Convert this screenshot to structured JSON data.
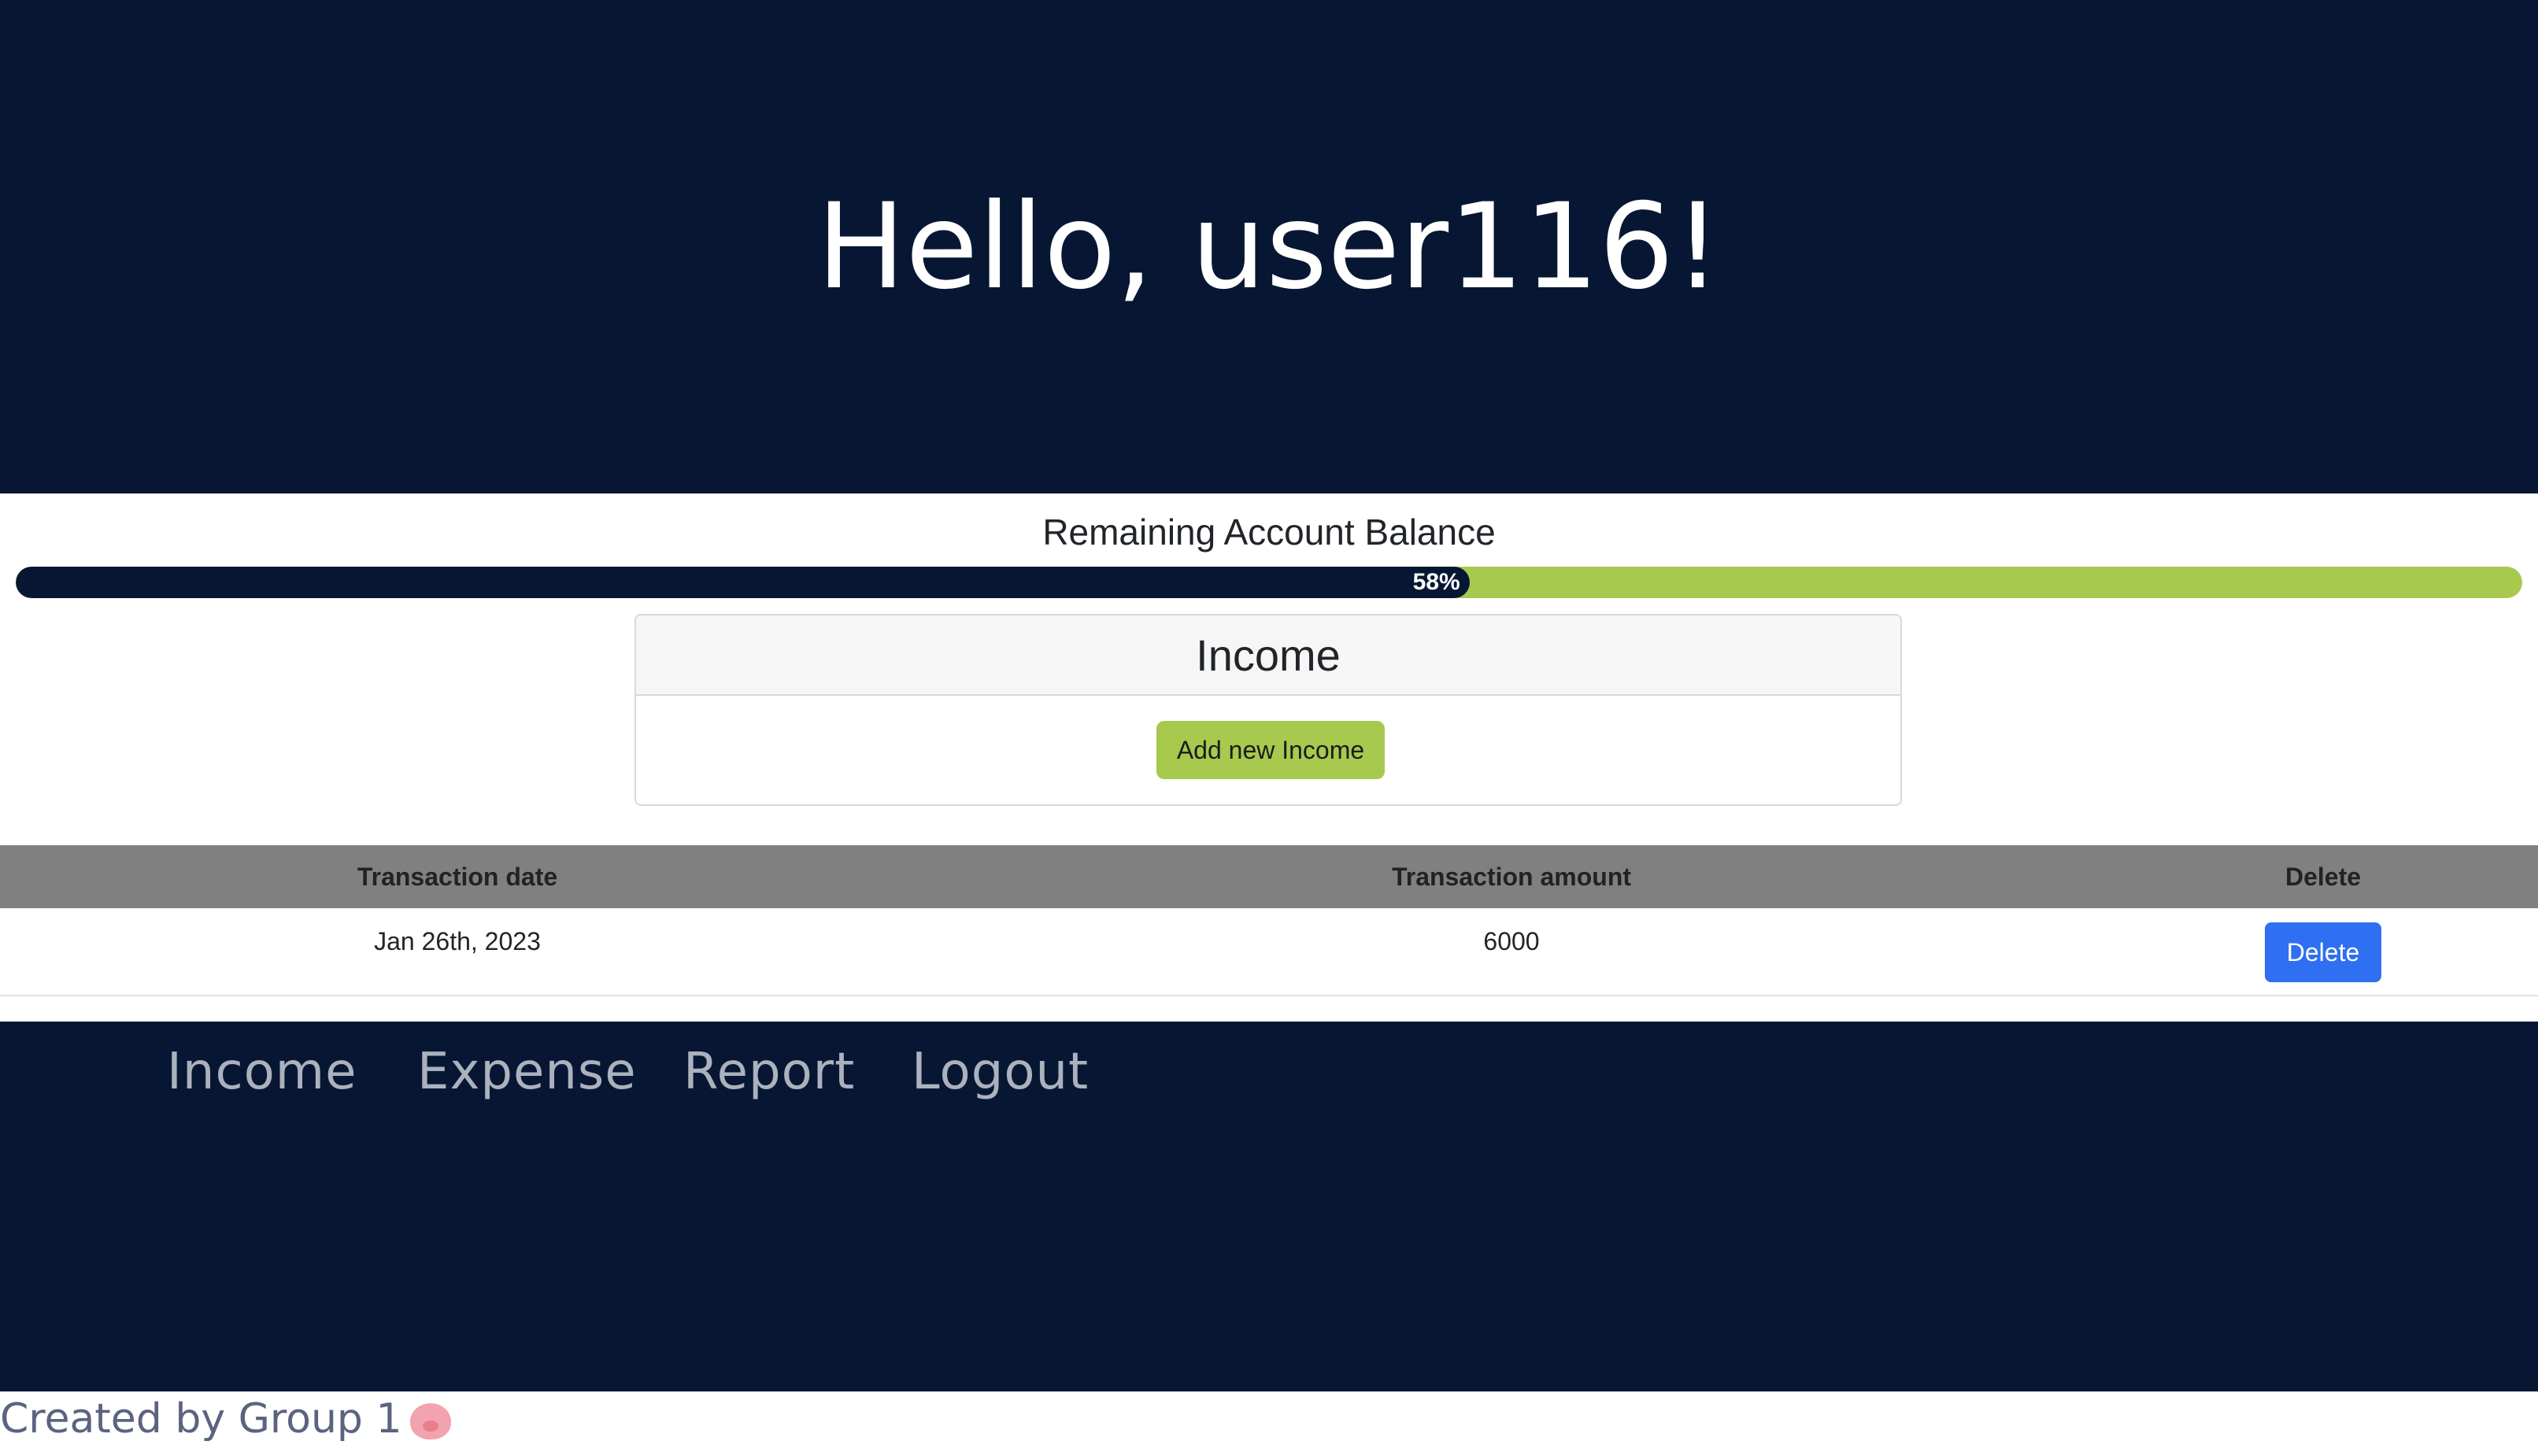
{
  "header": {
    "greeting": "Hello, user116!"
  },
  "balance": {
    "title": "Remaining Account Balance",
    "percent_label": "58%",
    "percent": 58,
    "colors": {
      "fill": "#071733",
      "track": "#a6c94e"
    }
  },
  "income_card": {
    "title": "Income",
    "add_button_label": "Add new Income"
  },
  "table": {
    "columns": [
      "Transaction date",
      "Transaction amount",
      "Delete"
    ],
    "rows": [
      {
        "date": "Jan 26th, 2023",
        "amount": "6000",
        "delete_label": "Delete"
      }
    ]
  },
  "nav": {
    "items": [
      "Income",
      "Expense",
      "Report",
      "Logout"
    ]
  },
  "footer": {
    "credit": "Created by Group 1",
    "credit_icon": "pig-face-icon"
  },
  "colors": {
    "brand_dark": "#071733",
    "accent_green": "#a6c94e",
    "button_blue": "#2f6ff2",
    "table_header": "#808080"
  }
}
